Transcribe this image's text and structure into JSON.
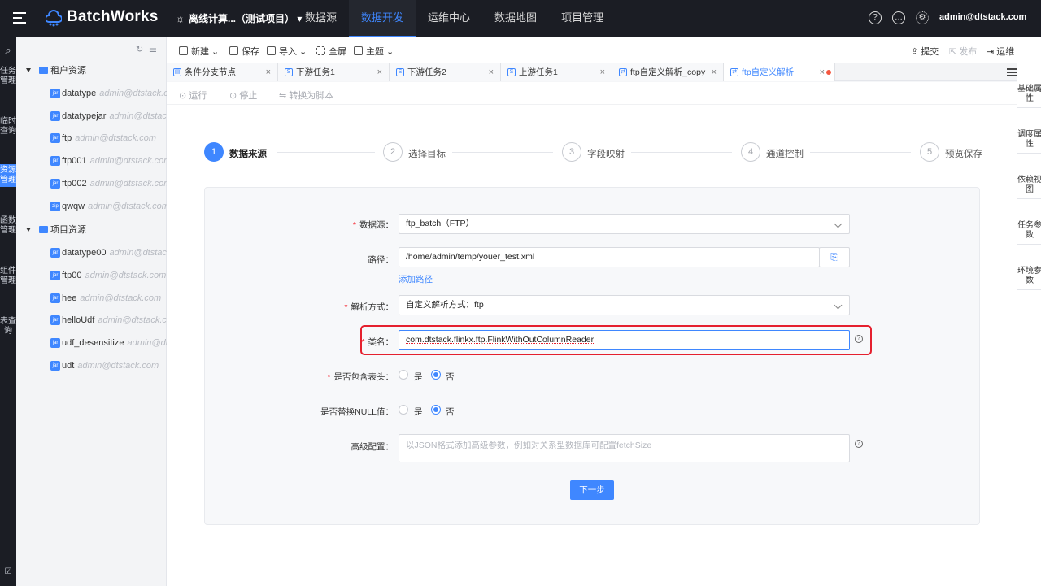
{
  "app": {
    "name": "BatchWorks",
    "project": "离线计算...（测试项目）"
  },
  "nav": [
    "数据源",
    "数据开发",
    "运维中心",
    "数据地图",
    "项目管理"
  ],
  "user": "admin@dtstack.com",
  "rail": [
    "任务管理",
    "临时查询",
    "资源管理",
    "函数管理",
    "组件管理",
    "表查询"
  ],
  "tree": {
    "groups": [
      {
        "label": "租户资源",
        "items": [
          {
            "name": "datatype",
            "user": "admin@dtstack.com",
            "icon": "jar"
          },
          {
            "name": "datatypejar",
            "user": "admin@dtstack.com",
            "icon": "jar"
          },
          {
            "name": "ftp",
            "user": "admin@dtstack.com",
            "icon": "jar"
          },
          {
            "name": "ftp001",
            "user": "admin@dtstack.com",
            "icon": "jar"
          },
          {
            "name": "ftp002",
            "user": "admin@dtstack.com",
            "icon": "jar"
          },
          {
            "name": "qwqw",
            "user": "admin@dtstack.com",
            "icon": "zip"
          }
        ]
      },
      {
        "label": "项目资源",
        "items": [
          {
            "name": "datatype00",
            "user": "admin@dtstack.com",
            "icon": "jar"
          },
          {
            "name": "ftp00",
            "user": "admin@dtstack.com",
            "icon": "jar"
          },
          {
            "name": "hee",
            "user": "admin@dtstack.com",
            "icon": "jar"
          },
          {
            "name": "helloUdf",
            "user": "admin@dtstack.com",
            "icon": "jar"
          },
          {
            "name": "udf_desensitize",
            "user": "admin@dtstack.com",
            "icon": "jar"
          },
          {
            "name": "udt",
            "user": "admin@dtstack.com",
            "icon": "jar"
          }
        ]
      }
    ]
  },
  "toolbar": {
    "new": "新建",
    "save": "保存",
    "import": "导入",
    "fullscreen": "全屏",
    "theme": "主题",
    "submit": "提交",
    "publish": "发布",
    "ops": "运维"
  },
  "tabs": [
    "条件分支节点",
    "下游任务1",
    "下游任务2",
    "上游任务1",
    "ftp自定义解析_copy",
    "ftp自定义解析"
  ],
  "runbar": {
    "run": "运行",
    "stop": "停止",
    "to_script": "转换为脚本"
  },
  "right_rail": [
    "基础属性",
    "调度属性",
    "依赖视图",
    "任务参数",
    "环境参数"
  ],
  "steps": [
    {
      "num": "1",
      "label": "数据来源"
    },
    {
      "num": "2",
      "label": "选择目标"
    },
    {
      "num": "3",
      "label": "字段映射"
    },
    {
      "num": "4",
      "label": "通道控制"
    },
    {
      "num": "5",
      "label": "预览保存"
    }
  ],
  "form": {
    "datasource_label": "数据源",
    "datasource_value": "ftp_batch（FTP）",
    "path_label": "路径",
    "path_value": "/home/admin/temp/youer_test.xml",
    "add_path": "添加路径",
    "parse_label": "解析方式",
    "parse_value": "自定义解析方式：ftp",
    "class_label": "类名",
    "class_value": "com.dtstack.flinkx.ftp.FlinkWithOutColumnReader",
    "header_label": "是否包含表头",
    "null_label": "是否替换NULL值",
    "yes": "是",
    "no": "否",
    "advanced_label": "高级配置",
    "advanced_placeholder": "以JSON格式添加高级参数，例如对关系型数据库可配置fetchSize",
    "next": "下一步"
  }
}
